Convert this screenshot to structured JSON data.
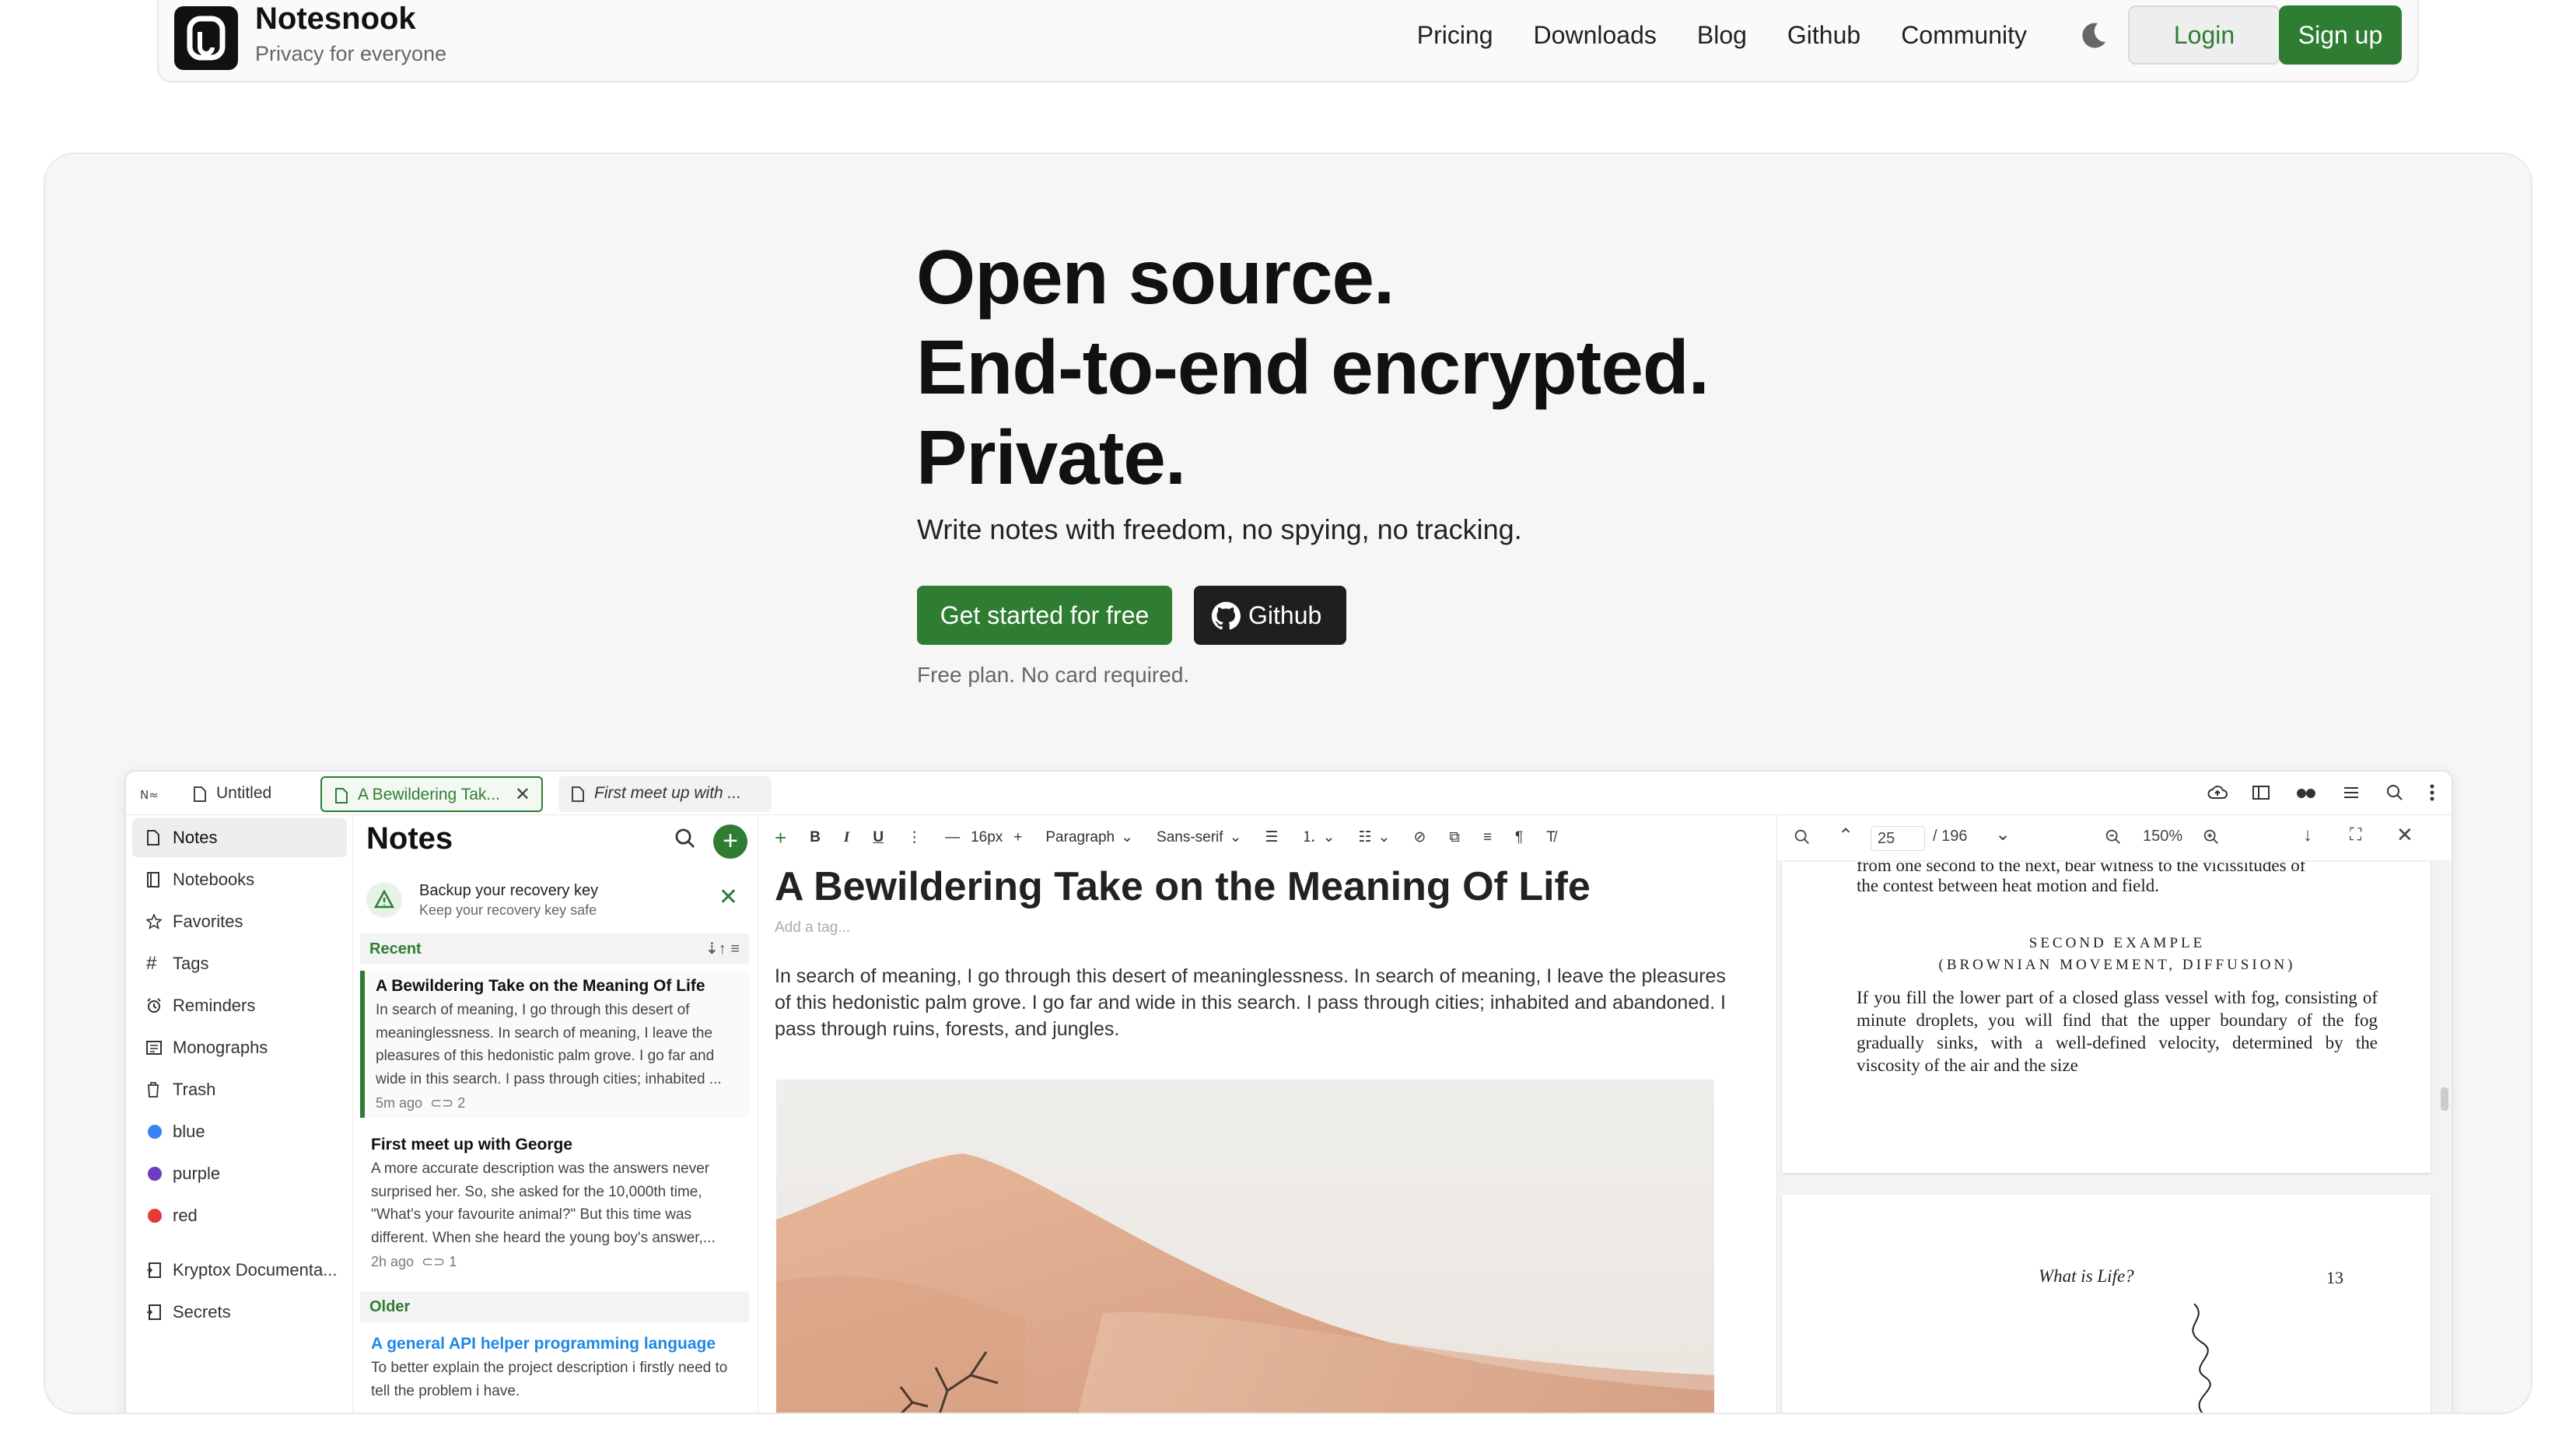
{
  "brand": {
    "name": "Notesnook",
    "tagline": "Privacy for everyone"
  },
  "nav": {
    "links": [
      "Pricing",
      "Downloads",
      "Blog",
      "Github",
      "Community"
    ],
    "login": "Login",
    "signup": "Sign up"
  },
  "hero": {
    "headline": [
      "Open source.",
      "End-to-end encrypted.",
      "Private."
    ],
    "subline": "Write notes with freedom, no spying, no tracking.",
    "cta_primary": "Get started for free",
    "cta_github": "Github",
    "note": "Free plan. No card required."
  },
  "app": {
    "tabs": [
      {
        "label": "Untitled",
        "state": "normal"
      },
      {
        "label": "A Bewildering Tak...",
        "state": "active"
      },
      {
        "label": "First meet up with ...",
        "state": "inactive"
      }
    ],
    "sidebar": [
      {
        "label": "Notes",
        "icon": "note-icon"
      },
      {
        "label": "Notebooks",
        "icon": "notebook-icon"
      },
      {
        "label": "Favorites",
        "icon": "star-icon"
      },
      {
        "label": "Tags",
        "icon": "hash-icon"
      },
      {
        "label": "Reminders",
        "icon": "alarm-icon"
      },
      {
        "label": "Monographs",
        "icon": "monograph-icon"
      },
      {
        "label": "Trash",
        "icon": "trash-icon"
      },
      {
        "label": "blue",
        "color": "#3b82f6"
      },
      {
        "label": "purple",
        "color": "#6d3fbf"
      },
      {
        "label": "red",
        "color": "#e53935"
      },
      {
        "label": "Kryptox Documenta...",
        "icon": "notebook-shortcut-icon"
      },
      {
        "label": "Secrets",
        "icon": "notebook-shortcut-icon"
      }
    ],
    "notes_list": {
      "title": "Notes",
      "backup_title": "Backup your recovery key",
      "backup_sub": "Keep your recovery key safe",
      "group_recent": "Recent",
      "group_older": "Older",
      "notes": [
        {
          "title": "A Bewildering Take on the Meaning Of Life",
          "body": "In search of meaning, I go through this desert of meaninglessness. In search of meaning, I leave the pleasures of this hedonistic palm grove. I go far and wide in this search. I pass through cities; inhabited ...",
          "meta": "5m ago",
          "count": "2"
        },
        {
          "title": "First meet up with George",
          "body": "A more accurate description was the answers never surprised her. So, she asked for the 10,000th time, \"What's your favourite animal?\" But this time was different. When she heard the young boy's answer,...",
          "meta": "2h ago",
          "count": "1"
        },
        {
          "title": "A general API helper programming language",
          "body": "To better explain the project description i firstly need to tell the problem i have."
        }
      ]
    },
    "editor": {
      "font_size": "16px",
      "block_type": "Paragraph",
      "font_family": "Sans-serif",
      "title": "A Bewildering Take on the Meaning Of Life",
      "tag_placeholder": "Add a tag...",
      "body": "In search of meaning, I go through this desert of meaninglessness. In search of meaning, I leave the pleasures of this hedonistic palm grove. I go far and wide in this search. I pass through cities; inhabited and abandoned. I pass through ruins, forests, and jungles."
    },
    "pdf": {
      "page": "25",
      "total": "/ 196",
      "zoom": "150%",
      "line_top": "from one second to the next, bear witness to the vicissitudes of",
      "line_top2": "the contest between heat motion and field.",
      "heading": "SECOND EXAMPLE",
      "subheading": "(BROWNIAN MOVEMENT, DIFFUSION)",
      "paragraph": "If you fill the lower part of a closed glass vessel with fog, consisting of minute droplets, you will find that the upper boundary of the fog gradually sinks, with a well-defined velocity, determined by the viscosity of the air and the size",
      "page2_title": "What is Life?",
      "page2_num": "13"
    }
  },
  "colors": {
    "accent": "#2e7d32",
    "dark_button": "#1f1f1f",
    "link": "#1e88e5"
  }
}
